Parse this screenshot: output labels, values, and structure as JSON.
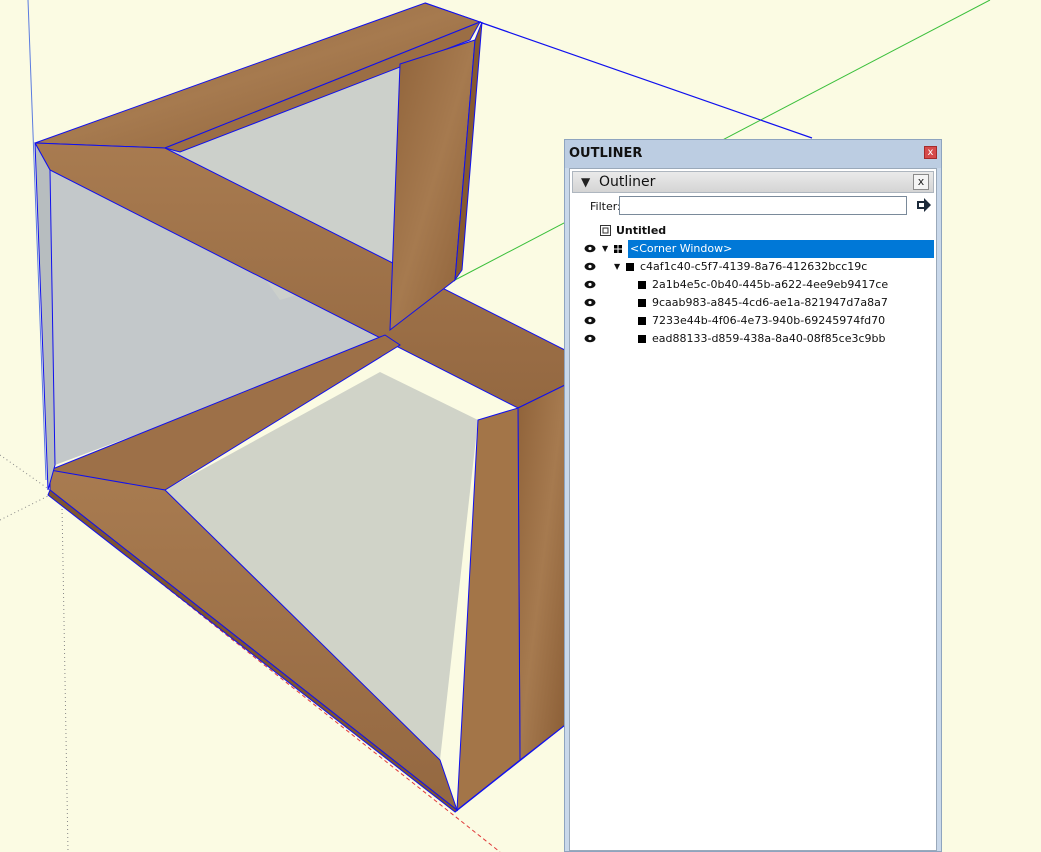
{
  "tray": {
    "title": "OUTLINER",
    "close_label": "x"
  },
  "panel": {
    "title": "Outliner",
    "close_label": "x",
    "filter_label": "Filter:",
    "filter_value": "",
    "filter_placeholder": ""
  },
  "tree": {
    "root": "Untitled",
    "items": [
      {
        "label": "<Corner Window>",
        "selected": true,
        "icon": "component-icon"
      },
      {
        "label": "c4af1c40-c5f7-4139-8a76-412632bcc19c",
        "icon": "group-icon"
      },
      {
        "label": "2a1b4e5c-0b40-445b-a622-4ee9eb9417ce",
        "icon": "group-icon"
      },
      {
        "label": "9caab983-a845-4cd6-ae1a-821947d7a8a7",
        "icon": "group-icon"
      },
      {
        "label": "7233e44b-4f06-4e73-940b-69245974fd70",
        "icon": "group-icon"
      },
      {
        "label": "ead88133-d859-438a-8a40-08f85ce3c9bb",
        "icon": "group-icon"
      }
    ]
  },
  "colors": {
    "background": "#fbfbe3",
    "wood": "#a0744a",
    "glass": "#c9cfd0",
    "selection_edge": "#0000ff",
    "selected_row": "#0078d7"
  }
}
